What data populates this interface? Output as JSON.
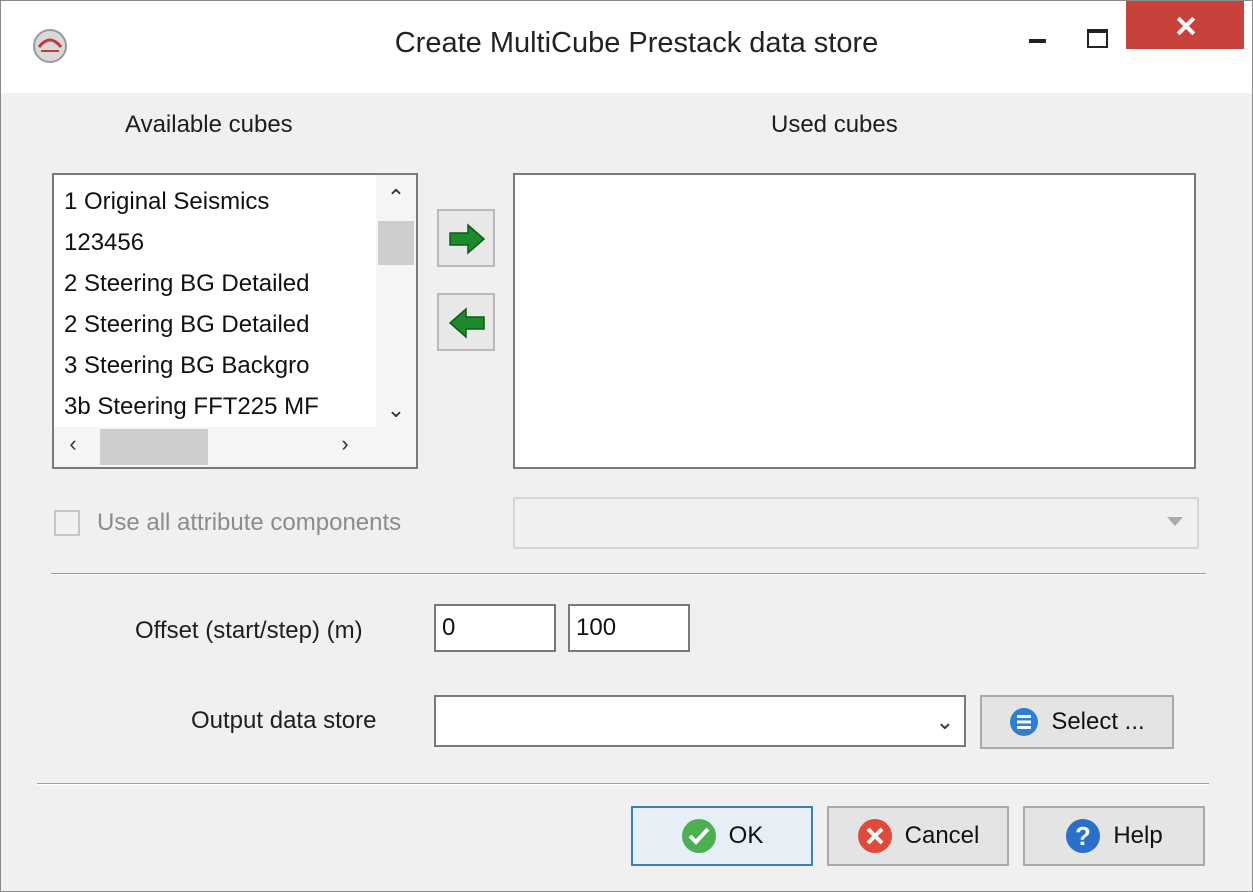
{
  "window": {
    "title": "Create MultiCube Prestack data store"
  },
  "available": {
    "label": "Available cubes",
    "items": [
      "1 Original Seismics",
      "123456",
      "2 Steering BG Detailed",
      "2 Steering BG Detailed",
      "3 Steering BG Backgro",
      "3b Steering FFT225 MF"
    ]
  },
  "used": {
    "label": "Used cubes",
    "items": []
  },
  "options": {
    "use_all_components_label": "Use all attribute components",
    "use_all_components_checked": false
  },
  "offset": {
    "label": "Offset (start/step) (m)",
    "start": "0",
    "step": "100"
  },
  "output": {
    "label": "Output data store",
    "value": "",
    "select_label": "Select ..."
  },
  "buttons": {
    "ok": "OK",
    "cancel": "Cancel",
    "help": "Help"
  },
  "colors": {
    "close": "#c7423a",
    "arrow_green": "#1e8a2e",
    "ok_green": "#4caf50",
    "cancel_red": "#e04a3a",
    "help_blue": "#2a6fc9",
    "select_blue": "#2b7fd4"
  }
}
